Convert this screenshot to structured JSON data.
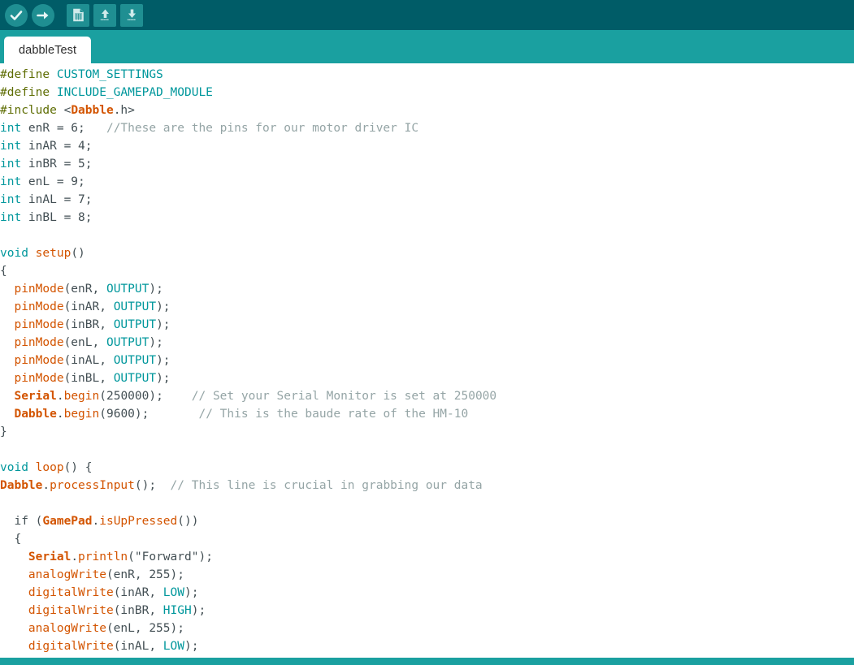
{
  "window": {
    "title": "dabbleTest",
    "colors": {
      "toolbar_bg": "#005c67",
      "tabbar_bg": "#1aa0a0",
      "tab_bg": "#ffffff",
      "icon_bg": "#1f8f92",
      "editor_bg": "#ffffff",
      "statusbar_bg": "#1aa0a0",
      "keyword": "#00979c",
      "function": "#d35400",
      "comment": "#95a5a6",
      "preprocessor": "#5e6d03",
      "plain": "#434f54"
    }
  },
  "toolbar": {
    "buttons": [
      {
        "name": "verify-button",
        "icon": "checkmark-icon",
        "label": "Verify"
      },
      {
        "name": "upload-button",
        "icon": "arrow-right-icon",
        "label": "Upload"
      },
      {
        "name": "new-button",
        "icon": "new-file-icon",
        "label": "New"
      },
      {
        "name": "open-button",
        "icon": "arrow-up-icon",
        "label": "Open"
      },
      {
        "name": "save-button",
        "icon": "arrow-down-icon",
        "label": "Save"
      }
    ]
  },
  "tabs": [
    {
      "label": "dabbleTest",
      "active": true
    }
  ],
  "editor": {
    "language": "arduino-cpp",
    "lines": [
      [
        {
          "t": "#define ",
          "c": "t-pre"
        },
        {
          "t": "CUSTOM_SETTINGS",
          "c": "t-const"
        }
      ],
      [
        {
          "t": "#define ",
          "c": "t-pre"
        },
        {
          "t": "INCLUDE_GAMEPAD_MODULE",
          "c": "t-const"
        }
      ],
      [
        {
          "t": "#include ",
          "c": "t-pre"
        },
        {
          "t": "<",
          "c": "t-plain"
        },
        {
          "t": "Dabble",
          "c": "t-obj"
        },
        {
          "t": ".h>",
          "c": "t-plain"
        }
      ],
      [
        {
          "t": "int",
          "c": "t-kw"
        },
        {
          "t": " enR = 6;   ",
          "c": "t-plain"
        },
        {
          "t": "//These are the pins for our motor driver IC",
          "c": "t-cmt"
        }
      ],
      [
        {
          "t": "int",
          "c": "t-kw"
        },
        {
          "t": " inAR = 4;",
          "c": "t-plain"
        }
      ],
      [
        {
          "t": "int",
          "c": "t-kw"
        },
        {
          "t": " inBR = 5;",
          "c": "t-plain"
        }
      ],
      [
        {
          "t": "int",
          "c": "t-kw"
        },
        {
          "t": " enL = 9;",
          "c": "t-plain"
        }
      ],
      [
        {
          "t": "int",
          "c": "t-kw"
        },
        {
          "t": " inAL = 7;",
          "c": "t-plain"
        }
      ],
      [
        {
          "t": "int",
          "c": "t-kw"
        },
        {
          "t": " inBL = 8;",
          "c": "t-plain"
        }
      ],
      [
        {
          "t": "",
          "c": "t-plain"
        }
      ],
      [
        {
          "t": "void",
          "c": "t-kw"
        },
        {
          "t": " ",
          "c": "t-plain"
        },
        {
          "t": "setup",
          "c": "t-func"
        },
        {
          "t": "()",
          "c": "t-plain"
        }
      ],
      [
        {
          "t": "{",
          "c": "t-plain"
        }
      ],
      [
        {
          "t": "  ",
          "c": "t-plain"
        },
        {
          "t": "pinMode",
          "c": "t-func"
        },
        {
          "t": "(enR, ",
          "c": "t-plain"
        },
        {
          "t": "OUTPUT",
          "c": "t-const"
        },
        {
          "t": ");",
          "c": "t-plain"
        }
      ],
      [
        {
          "t": "  ",
          "c": "t-plain"
        },
        {
          "t": "pinMode",
          "c": "t-func"
        },
        {
          "t": "(inAR, ",
          "c": "t-plain"
        },
        {
          "t": "OUTPUT",
          "c": "t-const"
        },
        {
          "t": ");",
          "c": "t-plain"
        }
      ],
      [
        {
          "t": "  ",
          "c": "t-plain"
        },
        {
          "t": "pinMode",
          "c": "t-func"
        },
        {
          "t": "(inBR, ",
          "c": "t-plain"
        },
        {
          "t": "OUTPUT",
          "c": "t-const"
        },
        {
          "t": ");",
          "c": "t-plain"
        }
      ],
      [
        {
          "t": "  ",
          "c": "t-plain"
        },
        {
          "t": "pinMode",
          "c": "t-func"
        },
        {
          "t": "(enL, ",
          "c": "t-plain"
        },
        {
          "t": "OUTPUT",
          "c": "t-const"
        },
        {
          "t": ");",
          "c": "t-plain"
        }
      ],
      [
        {
          "t": "  ",
          "c": "t-plain"
        },
        {
          "t": "pinMode",
          "c": "t-func"
        },
        {
          "t": "(inAL, ",
          "c": "t-plain"
        },
        {
          "t": "OUTPUT",
          "c": "t-const"
        },
        {
          "t": ");",
          "c": "t-plain"
        }
      ],
      [
        {
          "t": "  ",
          "c": "t-plain"
        },
        {
          "t": "pinMode",
          "c": "t-func"
        },
        {
          "t": "(inBL, ",
          "c": "t-plain"
        },
        {
          "t": "OUTPUT",
          "c": "t-const"
        },
        {
          "t": ");",
          "c": "t-plain"
        }
      ],
      [
        {
          "t": "  ",
          "c": "t-plain"
        },
        {
          "t": "Serial",
          "c": "t-obj"
        },
        {
          "t": ".",
          "c": "t-plain"
        },
        {
          "t": "begin",
          "c": "t-func"
        },
        {
          "t": "(250000);    ",
          "c": "t-plain"
        },
        {
          "t": "// Set your Serial Monitor is set at 250000",
          "c": "t-cmt"
        }
      ],
      [
        {
          "t": "  ",
          "c": "t-plain"
        },
        {
          "t": "Dabble",
          "c": "t-obj"
        },
        {
          "t": ".",
          "c": "t-plain"
        },
        {
          "t": "begin",
          "c": "t-func"
        },
        {
          "t": "(9600);       ",
          "c": "t-plain"
        },
        {
          "t": "// This is the baude rate of the HM-10",
          "c": "t-cmt"
        }
      ],
      [
        {
          "t": "}",
          "c": "t-plain"
        }
      ],
      [
        {
          "t": "",
          "c": "t-plain"
        }
      ],
      [
        {
          "t": "void",
          "c": "t-kw"
        },
        {
          "t": " ",
          "c": "t-plain"
        },
        {
          "t": "loop",
          "c": "t-func"
        },
        {
          "t": "() {",
          "c": "t-plain"
        }
      ],
      [
        {
          "t": "Dabble",
          "c": "t-obj"
        },
        {
          "t": ".",
          "c": "t-plain"
        },
        {
          "t": "processInput",
          "c": "t-func"
        },
        {
          "t": "();  ",
          "c": "t-plain"
        },
        {
          "t": "// This line is crucial in grabbing our data",
          "c": "t-cmt"
        }
      ],
      [
        {
          "t": "",
          "c": "t-plain"
        }
      ],
      [
        {
          "t": "  if (",
          "c": "t-plain"
        },
        {
          "t": "GamePad",
          "c": "t-obj"
        },
        {
          "t": ".",
          "c": "t-plain"
        },
        {
          "t": "isUpPressed",
          "c": "t-func"
        },
        {
          "t": "())",
          "c": "t-plain"
        }
      ],
      [
        {
          "t": "  {",
          "c": "t-plain"
        }
      ],
      [
        {
          "t": "    ",
          "c": "t-plain"
        },
        {
          "t": "Serial",
          "c": "t-obj"
        },
        {
          "t": ".",
          "c": "t-plain"
        },
        {
          "t": "println",
          "c": "t-func"
        },
        {
          "t": "(",
          "c": "t-plain"
        },
        {
          "t": "\"Forward\"",
          "c": "t-str"
        },
        {
          "t": ");",
          "c": "t-plain"
        }
      ],
      [
        {
          "t": "    ",
          "c": "t-plain"
        },
        {
          "t": "analogWrite",
          "c": "t-func"
        },
        {
          "t": "(enR, 255);",
          "c": "t-plain"
        }
      ],
      [
        {
          "t": "    ",
          "c": "t-plain"
        },
        {
          "t": "digitalWrite",
          "c": "t-func"
        },
        {
          "t": "(inAR, ",
          "c": "t-plain"
        },
        {
          "t": "LOW",
          "c": "t-const"
        },
        {
          "t": ");",
          "c": "t-plain"
        }
      ],
      [
        {
          "t": "    ",
          "c": "t-plain"
        },
        {
          "t": "digitalWrite",
          "c": "t-func"
        },
        {
          "t": "(inBR, ",
          "c": "t-plain"
        },
        {
          "t": "HIGH",
          "c": "t-const"
        },
        {
          "t": ");",
          "c": "t-plain"
        }
      ],
      [
        {
          "t": "    ",
          "c": "t-plain"
        },
        {
          "t": "analogWrite",
          "c": "t-func"
        },
        {
          "t": "(enL, 255);",
          "c": "t-plain"
        }
      ],
      [
        {
          "t": "    ",
          "c": "t-plain"
        },
        {
          "t": "digitalWrite",
          "c": "t-func"
        },
        {
          "t": "(inAL, ",
          "c": "t-plain"
        },
        {
          "t": "LOW",
          "c": "t-const"
        },
        {
          "t": ");",
          "c": "t-plain"
        }
      ]
    ]
  }
}
